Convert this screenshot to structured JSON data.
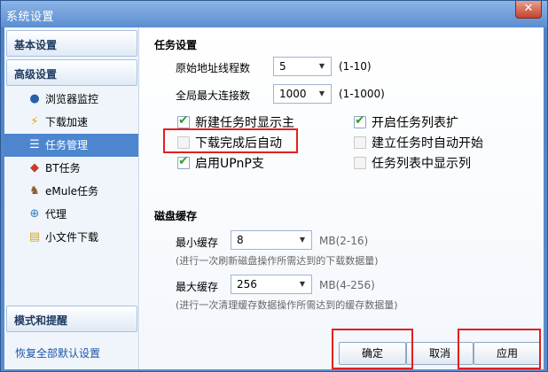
{
  "window": {
    "title": "系统设置",
    "close_label": "✕"
  },
  "sidebar": {
    "basic_header": "基本设置",
    "advanced_header": "高级设置",
    "items": [
      {
        "label": "浏览器监控",
        "icon": "●"
      },
      {
        "label": "下载加速",
        "icon": "⚡"
      },
      {
        "label": "任务管理",
        "icon": "☰"
      },
      {
        "label": "BT任务",
        "icon": "◆"
      },
      {
        "label": "eMule任务",
        "icon": "♞"
      },
      {
        "label": "代理",
        "icon": "⊕"
      },
      {
        "label": "小文件下载",
        "icon": "▤"
      }
    ],
    "mode_header": "模式和提醒",
    "restore_link": "恢复全部默认设置"
  },
  "task_settings": {
    "title": "任务设置",
    "origin_threads_label": "原始地址线程数",
    "origin_threads_value": "5",
    "origin_threads_hint": "(1-10)",
    "max_conn_label": "全局最大连接数",
    "max_conn_value": "1000",
    "max_conn_hint": "(1-1000)",
    "checkboxes": {
      "new_task_show": "新建任务时显示主",
      "open_task_list": "开启任务列表扩",
      "auto_after_done": "下载完成后自动",
      "auto_on_create": "建立任务时自动开始",
      "enable_upnp": "启用UPnP支",
      "task_list_show": "任务列表中显示列"
    }
  },
  "disk_cache": {
    "title": "磁盘缓存",
    "min_label": "最小缓存",
    "min_value": "8",
    "min_unit": "MB(2-16)",
    "min_desc": "(进行一次刷新磁盘操作所需达到的下载数据量)",
    "max_label": "最大缓存",
    "max_value": "256",
    "max_unit": "MB(4-256)",
    "max_desc": "(进行一次清理缓存数据操作所需达到的缓存数据量)"
  },
  "buttons": {
    "ok": "确定",
    "cancel": "取消",
    "apply": "应用"
  },
  "colors": {
    "accent": "#4d86cf",
    "highlight": "#e31f1f"
  }
}
